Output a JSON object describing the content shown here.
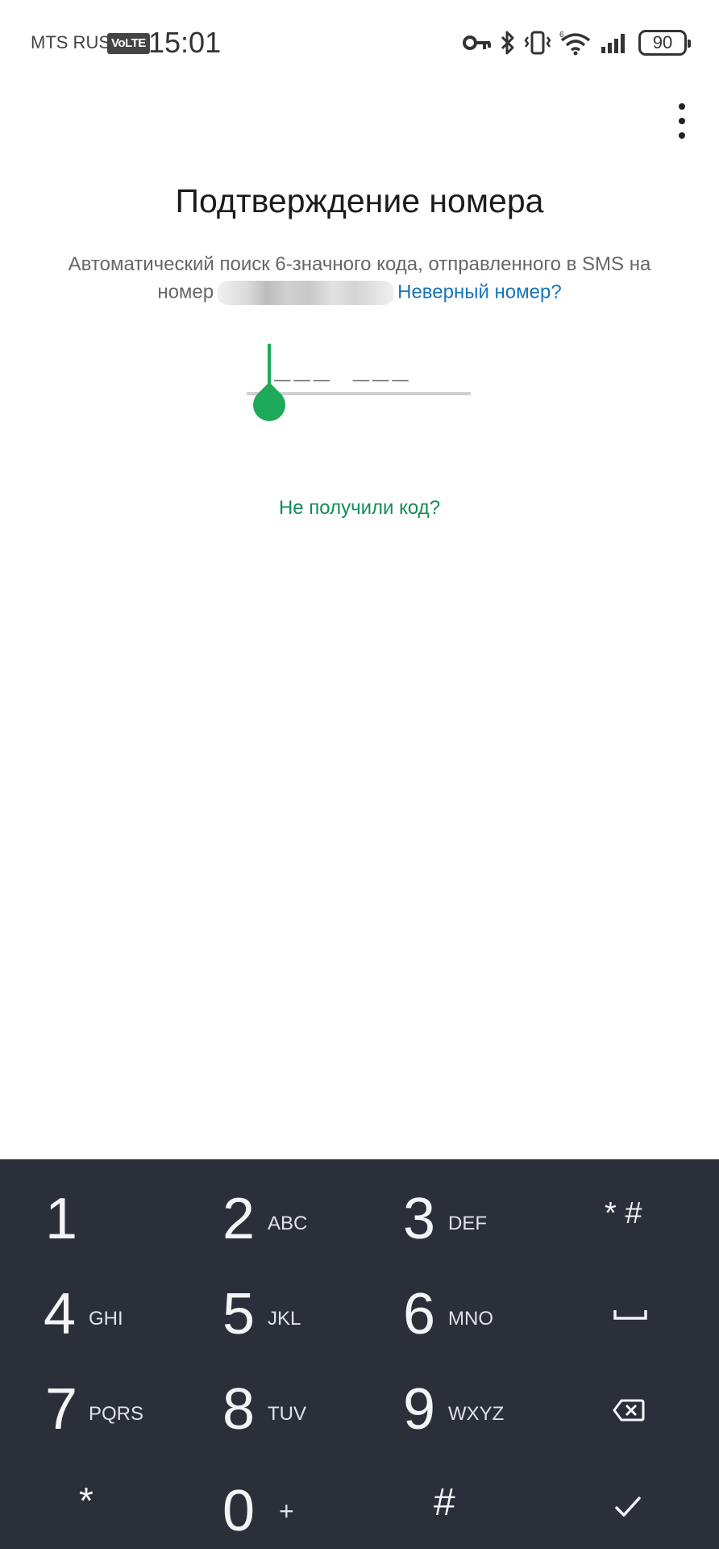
{
  "status_bar": {
    "carrier": "MTS RUS",
    "volte": "VoLTE",
    "time": "15:01",
    "battery": "90",
    "icons": [
      "key-icon",
      "bluetooth-icon",
      "vibrate-icon",
      "wifi-6-icon",
      "signal-icon",
      "battery-icon"
    ]
  },
  "header": {
    "menu_icon": "more-vert-icon"
  },
  "verify": {
    "title": "Подтверждение номера",
    "description_line1": "Автоматический поиск 6-значного кода, отправленного в SMS на",
    "description_prefix": "номер",
    "wrong_number": "Неверный номер?",
    "code_placeholder": "___ ___",
    "code_value": "",
    "resend": "Не получили код?"
  },
  "keypad": {
    "keys": [
      {
        "num": "1",
        "sub": ""
      },
      {
        "num": "2",
        "sub": "ABC"
      },
      {
        "num": "3",
        "sub": "DEF"
      },
      {
        "num": "* #",
        "sub": ""
      },
      {
        "num": "4",
        "sub": "GHI"
      },
      {
        "num": "5",
        "sub": "JKL"
      },
      {
        "num": "6",
        "sub": "MNO"
      },
      {
        "num": "␣",
        "sub": ""
      },
      {
        "num": "7",
        "sub": "PQRS"
      },
      {
        "num": "8",
        "sub": "TUV"
      },
      {
        "num": "9",
        "sub": "WXYZ"
      },
      {
        "num": "⌫",
        "sub": ""
      },
      {
        "num": "*",
        "sub": ""
      },
      {
        "num": "0",
        "sub": "+"
      },
      {
        "num": "#",
        "sub": ""
      },
      {
        "num": "✓",
        "sub": ""
      }
    ]
  },
  "colors": {
    "accent_green": "#1eaa5a",
    "link_blue": "#1a73b8",
    "keypad_bg": "#2a2f3a"
  }
}
